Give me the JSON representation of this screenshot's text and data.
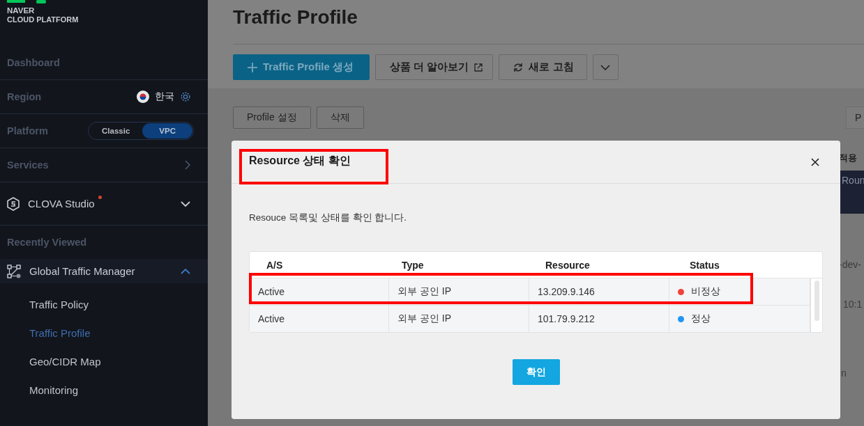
{
  "sidebar": {
    "logo": [
      "NAVER",
      "CLOUD PLATFORM"
    ],
    "dashboard": "Dashboard",
    "region": {
      "label": "Region",
      "value": "한국"
    },
    "platform": {
      "label": "Platform",
      "options": [
        {
          "label": "Classic",
          "selected": false
        },
        {
          "label": "VPC",
          "selected": true
        }
      ]
    },
    "services": "Services",
    "clova": {
      "label": "CLOVA Studio",
      "new": true,
      "expanded": false
    },
    "recent_label": "Recently Viewed",
    "recent": {
      "label": "Global Traffic Manager",
      "expanded": true,
      "children": [
        {
          "label": "Traffic Policy",
          "selected": false
        },
        {
          "label": "Traffic Profile",
          "selected": true
        },
        {
          "label": "Geo/CIDR Map",
          "selected": false
        },
        {
          "label": "Monitoring",
          "selected": false
        }
      ]
    }
  },
  "page": {
    "title": "Traffic Profile",
    "toolbar": [
      {
        "kind": "primary",
        "label": "Traffic Profile 생성"
      },
      {
        "kind": "external",
        "label": "상품 더 알아보기"
      },
      {
        "kind": "refresh",
        "label": "새로 고침"
      },
      {
        "kind": "more"
      }
    ],
    "actions": [
      "Profile 설정",
      "삭제"
    ],
    "behind": {
      "button": "P",
      "column_header": "적용",
      "table_header": "Roun",
      "cell_1": "-dev-",
      "cell_2": "10:1",
      "cell_3": "n"
    }
  },
  "dialog": {
    "title": "Resource 상태 확인",
    "title_highlighted": true,
    "message": "Resouce 목록및 상태를 확인 합니다.",
    "columns": [
      "A/S",
      "Type",
      "Resource",
      "Status"
    ],
    "rows": [
      {
        "as": "Active",
        "type": "외부 공인 IP",
        "resource": "13.209.9.146",
        "status": "비정상",
        "color": "#f04438",
        "highlighted": true
      },
      {
        "as": "Active",
        "type": "외부 공인 IP",
        "resource": "101.79.9.212",
        "status": "정상",
        "color": "#2196f3",
        "highlighted": false
      }
    ],
    "confirm": "확인"
  }
}
